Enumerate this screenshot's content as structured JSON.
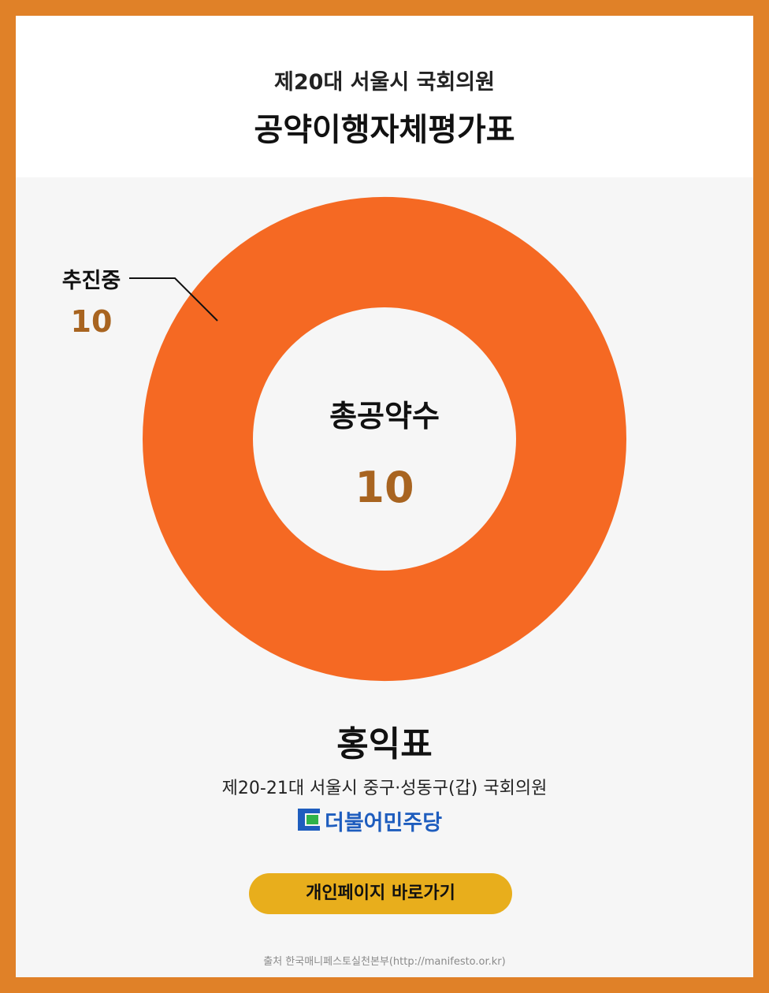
{
  "header": {
    "subtitle": "제20대 서울시 국회의원",
    "title": "공약이행자체평가표"
  },
  "chart_data": {
    "type": "pie",
    "categories": [
      "추진중"
    ],
    "values": [
      10
    ],
    "colors": [
      "#F56923"
    ],
    "donut": true,
    "center_label": "총공약수",
    "center_value": "10"
  },
  "member": {
    "name": "홍익표",
    "position": "제20-21대 서울시 중구·성동구(갑) 국회의원",
    "party": "더불어민주당"
  },
  "button": {
    "label": "개인페이지 바로가기"
  },
  "source": "출처 한국매니페스토실천본부(http://manifesto.or.kr)",
  "colors": {
    "frame": "#E08128",
    "accent_value": "#A86420",
    "button": "#E8AE1C",
    "party_blue": "#1E5DBE",
    "party_green": "#2FB34A"
  }
}
